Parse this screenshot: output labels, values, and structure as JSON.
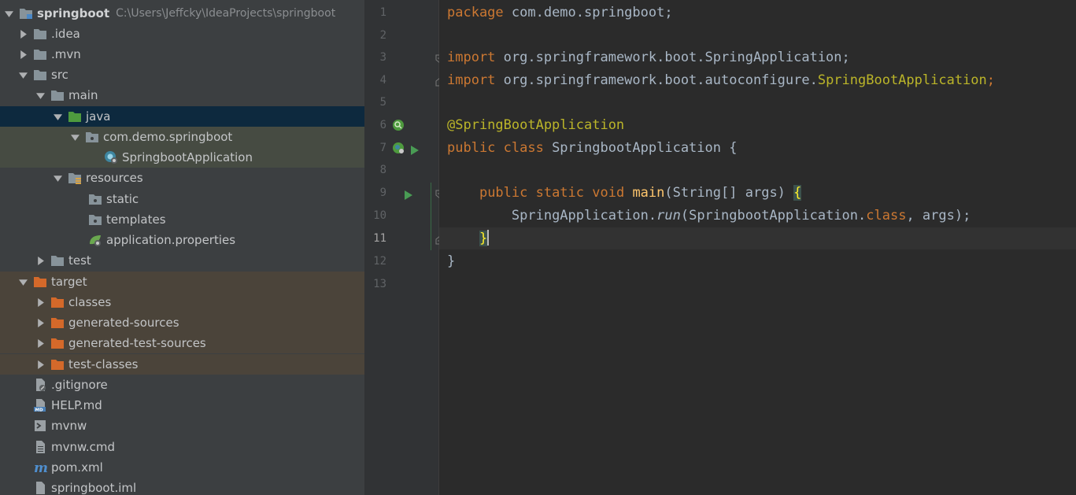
{
  "project_tree": {
    "root": {
      "label": "springboot",
      "path": "C:\\Users\\Jeffcky\\IdeaProjects\\springboot"
    },
    "items": [
      {
        "label": ".idea"
      },
      {
        "label": ".mvn"
      },
      {
        "label": "src"
      },
      {
        "label": "main"
      },
      {
        "label": "java"
      },
      {
        "label": "com.demo.springboot"
      },
      {
        "label": "SpringbootApplication"
      },
      {
        "label": "resources"
      },
      {
        "label": "static"
      },
      {
        "label": "templates"
      },
      {
        "label": "application.properties"
      },
      {
        "label": "test"
      },
      {
        "label": "target"
      },
      {
        "label": "classes"
      },
      {
        "label": "generated-sources"
      },
      {
        "label": "generated-test-sources"
      },
      {
        "label": "test-classes"
      },
      {
        "label": ".gitignore"
      },
      {
        "label": "HELP.md"
      },
      {
        "label": "mvnw"
      },
      {
        "label": "mvnw.cmd"
      },
      {
        "label": "pom.xml"
      },
      {
        "label": "springboot.iml"
      }
    ]
  },
  "gutter": {
    "line_numbers": [
      "1",
      "2",
      "3",
      "4",
      "5",
      "6",
      "7",
      "8",
      "9",
      "10",
      "11",
      "12",
      "13"
    ],
    "current_line": "11"
  },
  "code": {
    "l1_kw": "package",
    "l1_rest": " com.demo.springboot;",
    "l3_kw": "import",
    "l3_rest": " org.springframework.boot.SpringApplication;",
    "l4_kw": "import",
    "l4_pkg": " org.springframework.boot.autoconfigure.",
    "l4_cls": "SpringBootApplication",
    "l4_end": ";",
    "l6_ann": "@SpringBootApplication",
    "l7_kw": "public class",
    "l7_rest": " SpringbootApplication {",
    "l9_indent": "    ",
    "l9_kw": "public static void",
    "l9_sp": " ",
    "l9_fn": "main",
    "l9_rest": "(String[] args) ",
    "l9_brace": "{",
    "l10_indent": "        ",
    "l10_a": "SpringApplication.",
    "l10_run": "run",
    "l10_b": "(SpringbootApplication.",
    "l10_kw": "class",
    "l10_c": ", args);",
    "l11_indent": "    ",
    "l11_brace": "}",
    "l12": "}"
  },
  "colors": {
    "sidebar_bg": "#3c3f41",
    "editor_bg": "#2b2b2b",
    "keyword": "#cc7832",
    "annotation": "#bbb529",
    "method": "#ffc66d",
    "text": "#a9b7c6"
  }
}
